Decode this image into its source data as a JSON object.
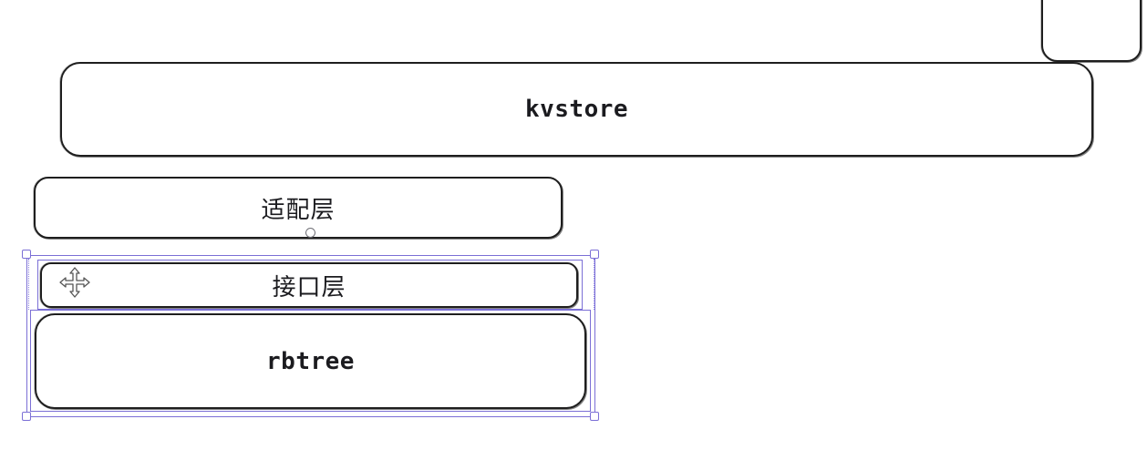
{
  "diagram": {
    "nodes": {
      "kvstore": "kvstore",
      "adapter_layer": "适配层",
      "interface_layer": "接口层",
      "rbtree": "rbtree"
    },
    "selection_color": "#7b6fd6",
    "stroke_color": "#1e1e1e",
    "cursor_icon": "move-icon"
  }
}
